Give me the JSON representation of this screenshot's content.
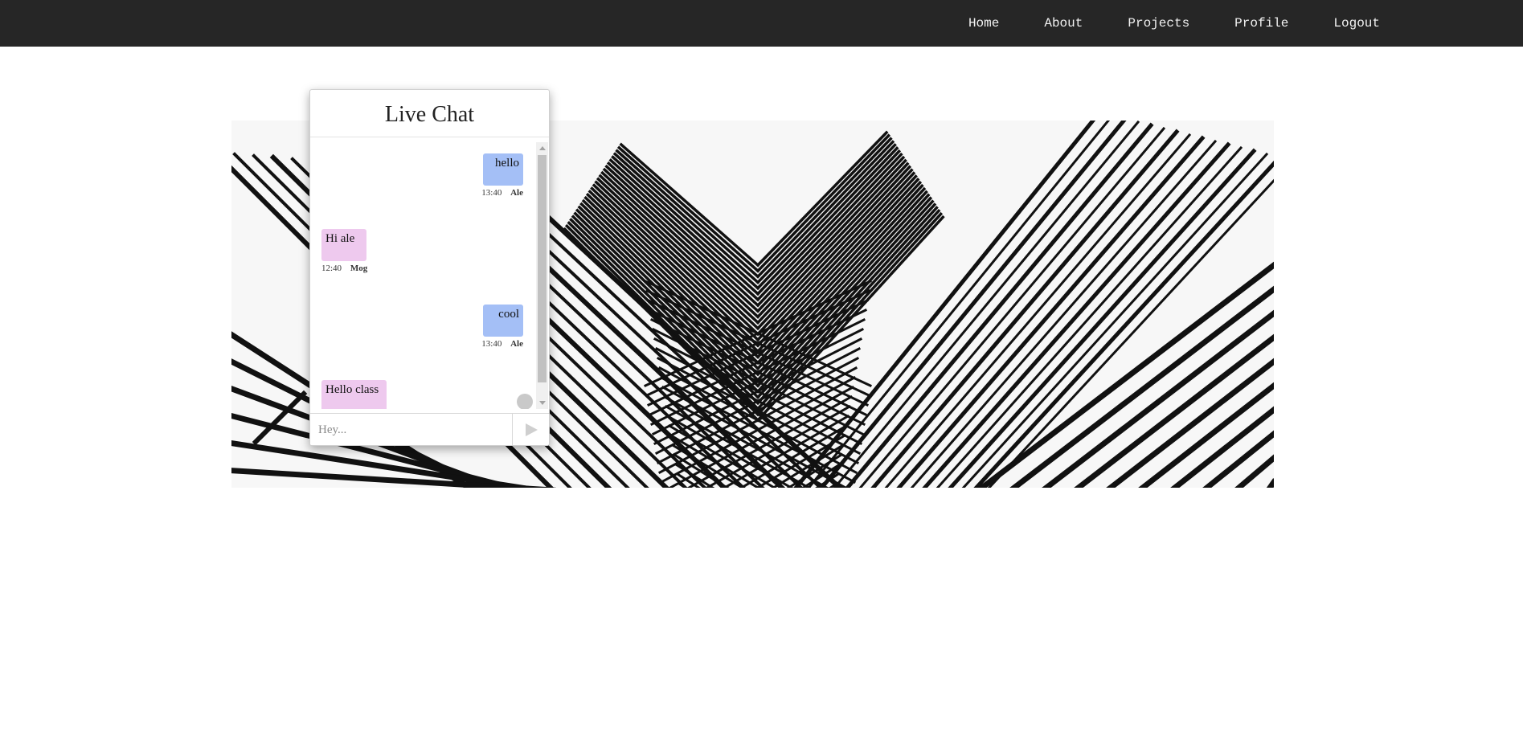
{
  "nav": {
    "items": [
      {
        "label": "Home"
      },
      {
        "label": "About"
      },
      {
        "label": "Projects"
      },
      {
        "label": "Profile"
      },
      {
        "label": "Logout"
      }
    ]
  },
  "hero": {
    "image": "architectural-lines-image"
  },
  "chat": {
    "title": "Live Chat",
    "messages": [
      {
        "text": "hello",
        "time": "13:40",
        "author": "Ale",
        "side": "right"
      },
      {
        "text": "Hi ale",
        "time": "12:40",
        "author": "Mog",
        "side": "left"
      },
      {
        "text": "cool",
        "time": "13:40",
        "author": "Ale",
        "side": "right"
      },
      {
        "text": "Hello class",
        "side": "left"
      }
    ],
    "input": {
      "placeholder": "Hey...",
      "value": ""
    },
    "send_icon": "send-triangle-icon",
    "colors": {
      "outgoing": "#a4bff6",
      "incoming": "#eec9ee"
    }
  }
}
